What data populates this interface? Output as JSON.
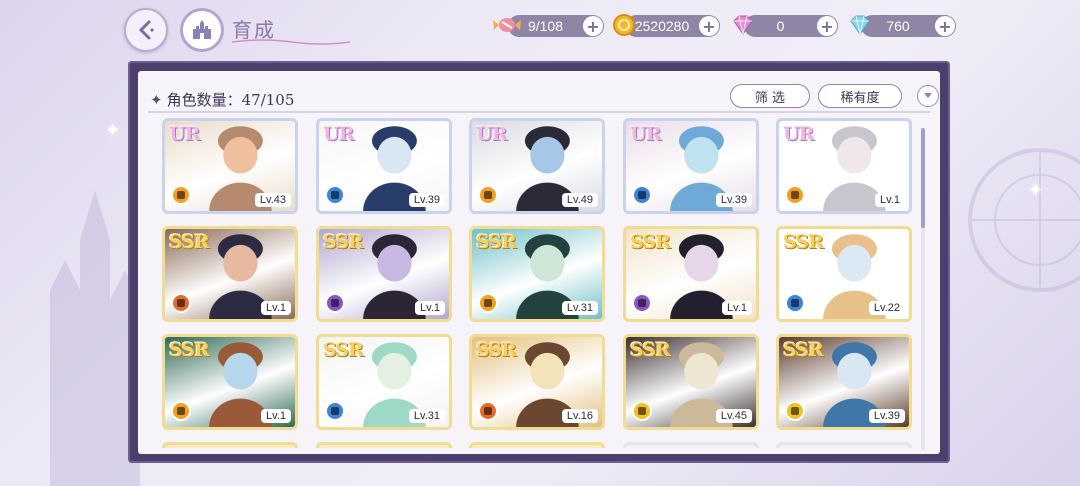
{
  "header": {
    "title": "育成",
    "back_icon": "back-arrow-icon",
    "home_icon": "castle-home-icon"
  },
  "resources": [
    {
      "name": "candy",
      "icon": "candy-icon",
      "value": "9/108",
      "color": "#e9828f"
    },
    {
      "name": "coin",
      "icon": "gold-coin-icon",
      "value": "2520280",
      "color": "#f2b42b"
    },
    {
      "name": "pink-diamond",
      "icon": "pink-diamond-icon",
      "value": "0",
      "color": "#d879c9"
    },
    {
      "name": "blue-diamond",
      "icon": "blue-diamond-icon",
      "value": "760",
      "color": "#7fd3ee"
    }
  ],
  "panel": {
    "count_label": "角色数量",
    "count_sep": "：",
    "count_value": "47/105",
    "filter_label": "筛 选",
    "rarity_sort_label": "稀有度"
  },
  "colors": {
    "panel_frame": "#4c3f6e",
    "ur_frame": "#c9d2ee",
    "ssr_frame": "#f0dc93"
  },
  "cards": [
    {
      "rarity": "UR",
      "level": "Lv.43",
      "attr_color": "#f2a020",
      "art": [
        "#f0c09e",
        "#b58a6e",
        "#e9dcc9"
      ]
    },
    {
      "rarity": "UR",
      "level": "Lv.39",
      "attr_color": "#3b84d8",
      "art": [
        "#d9e6f3",
        "#283d6a",
        "#f5f5f5"
      ]
    },
    {
      "rarity": "UR",
      "level": "Lv.49",
      "attr_color": "#f2a020",
      "art": [
        "#a7c7e8",
        "#2a2a38",
        "#d8dbe0"
      ]
    },
    {
      "rarity": "UR",
      "level": "Lv.39",
      "attr_color": "#3b84d8",
      "art": [
        "#bfe2f1",
        "#6fa9d8",
        "#e9dde8"
      ]
    },
    {
      "rarity": "UR",
      "level": "Lv.1",
      "attr_color": "#f2a020",
      "art": [
        "#f0e7ec",
        "#c9c5cf",
        "#ffffff"
      ]
    },
    {
      "rarity": "SSR",
      "level": "Lv.1",
      "attr_color": "#e66a2c",
      "art": [
        "#e6b9a0",
        "#2d2a44",
        "#8a6a55"
      ]
    },
    {
      "rarity": "SSR",
      "level": "Lv.1",
      "attr_color": "#8a55c9",
      "art": [
        "#c7b9e4",
        "#2b2536",
        "#b1a8cf"
      ]
    },
    {
      "rarity": "SSR",
      "level": "Lv.31",
      "attr_color": "#f2a020",
      "art": [
        "#cfe5d6",
        "#23413e",
        "#6fc0c8"
      ]
    },
    {
      "rarity": "SSR",
      "level": "Lv.1",
      "attr_color": "#8a55c9",
      "art": [
        "#e6d6ea",
        "#241f2e",
        "#f1e3c9"
      ]
    },
    {
      "rarity": "SSR",
      "level": "Lv.22",
      "attr_color": "#3b84d8",
      "art": [
        "#dbe9f4",
        "#e8c089",
        "#ffffff"
      ]
    },
    {
      "rarity": "SSR",
      "level": "Lv.1",
      "attr_color": "#f2a020",
      "art": [
        "#b6d6ee",
        "#9a5a3a",
        "#2f6a55"
      ]
    },
    {
      "rarity": "SSR",
      "level": "Lv.31",
      "attr_color": "#3b84d8",
      "art": [
        "#e3f0e2",
        "#9ed9c6",
        "#f3f3f3"
      ]
    },
    {
      "rarity": "SSR",
      "level": "Lv.16",
      "attr_color": "#e66a2c",
      "art": [
        "#f3e3b9",
        "#6b4630",
        "#e3c07e"
      ]
    },
    {
      "rarity": "SSR",
      "level": "Lv.45",
      "attr_color": "#f2c020",
      "art": [
        "#efe6d2",
        "#cbb99a",
        "#3a3030"
      ]
    },
    {
      "rarity": "SSR",
      "level": "Lv.39",
      "attr_color": "#f2c020",
      "art": [
        "#d7e8f4",
        "#3f78a8",
        "#5a3a2a"
      ]
    }
  ]
}
